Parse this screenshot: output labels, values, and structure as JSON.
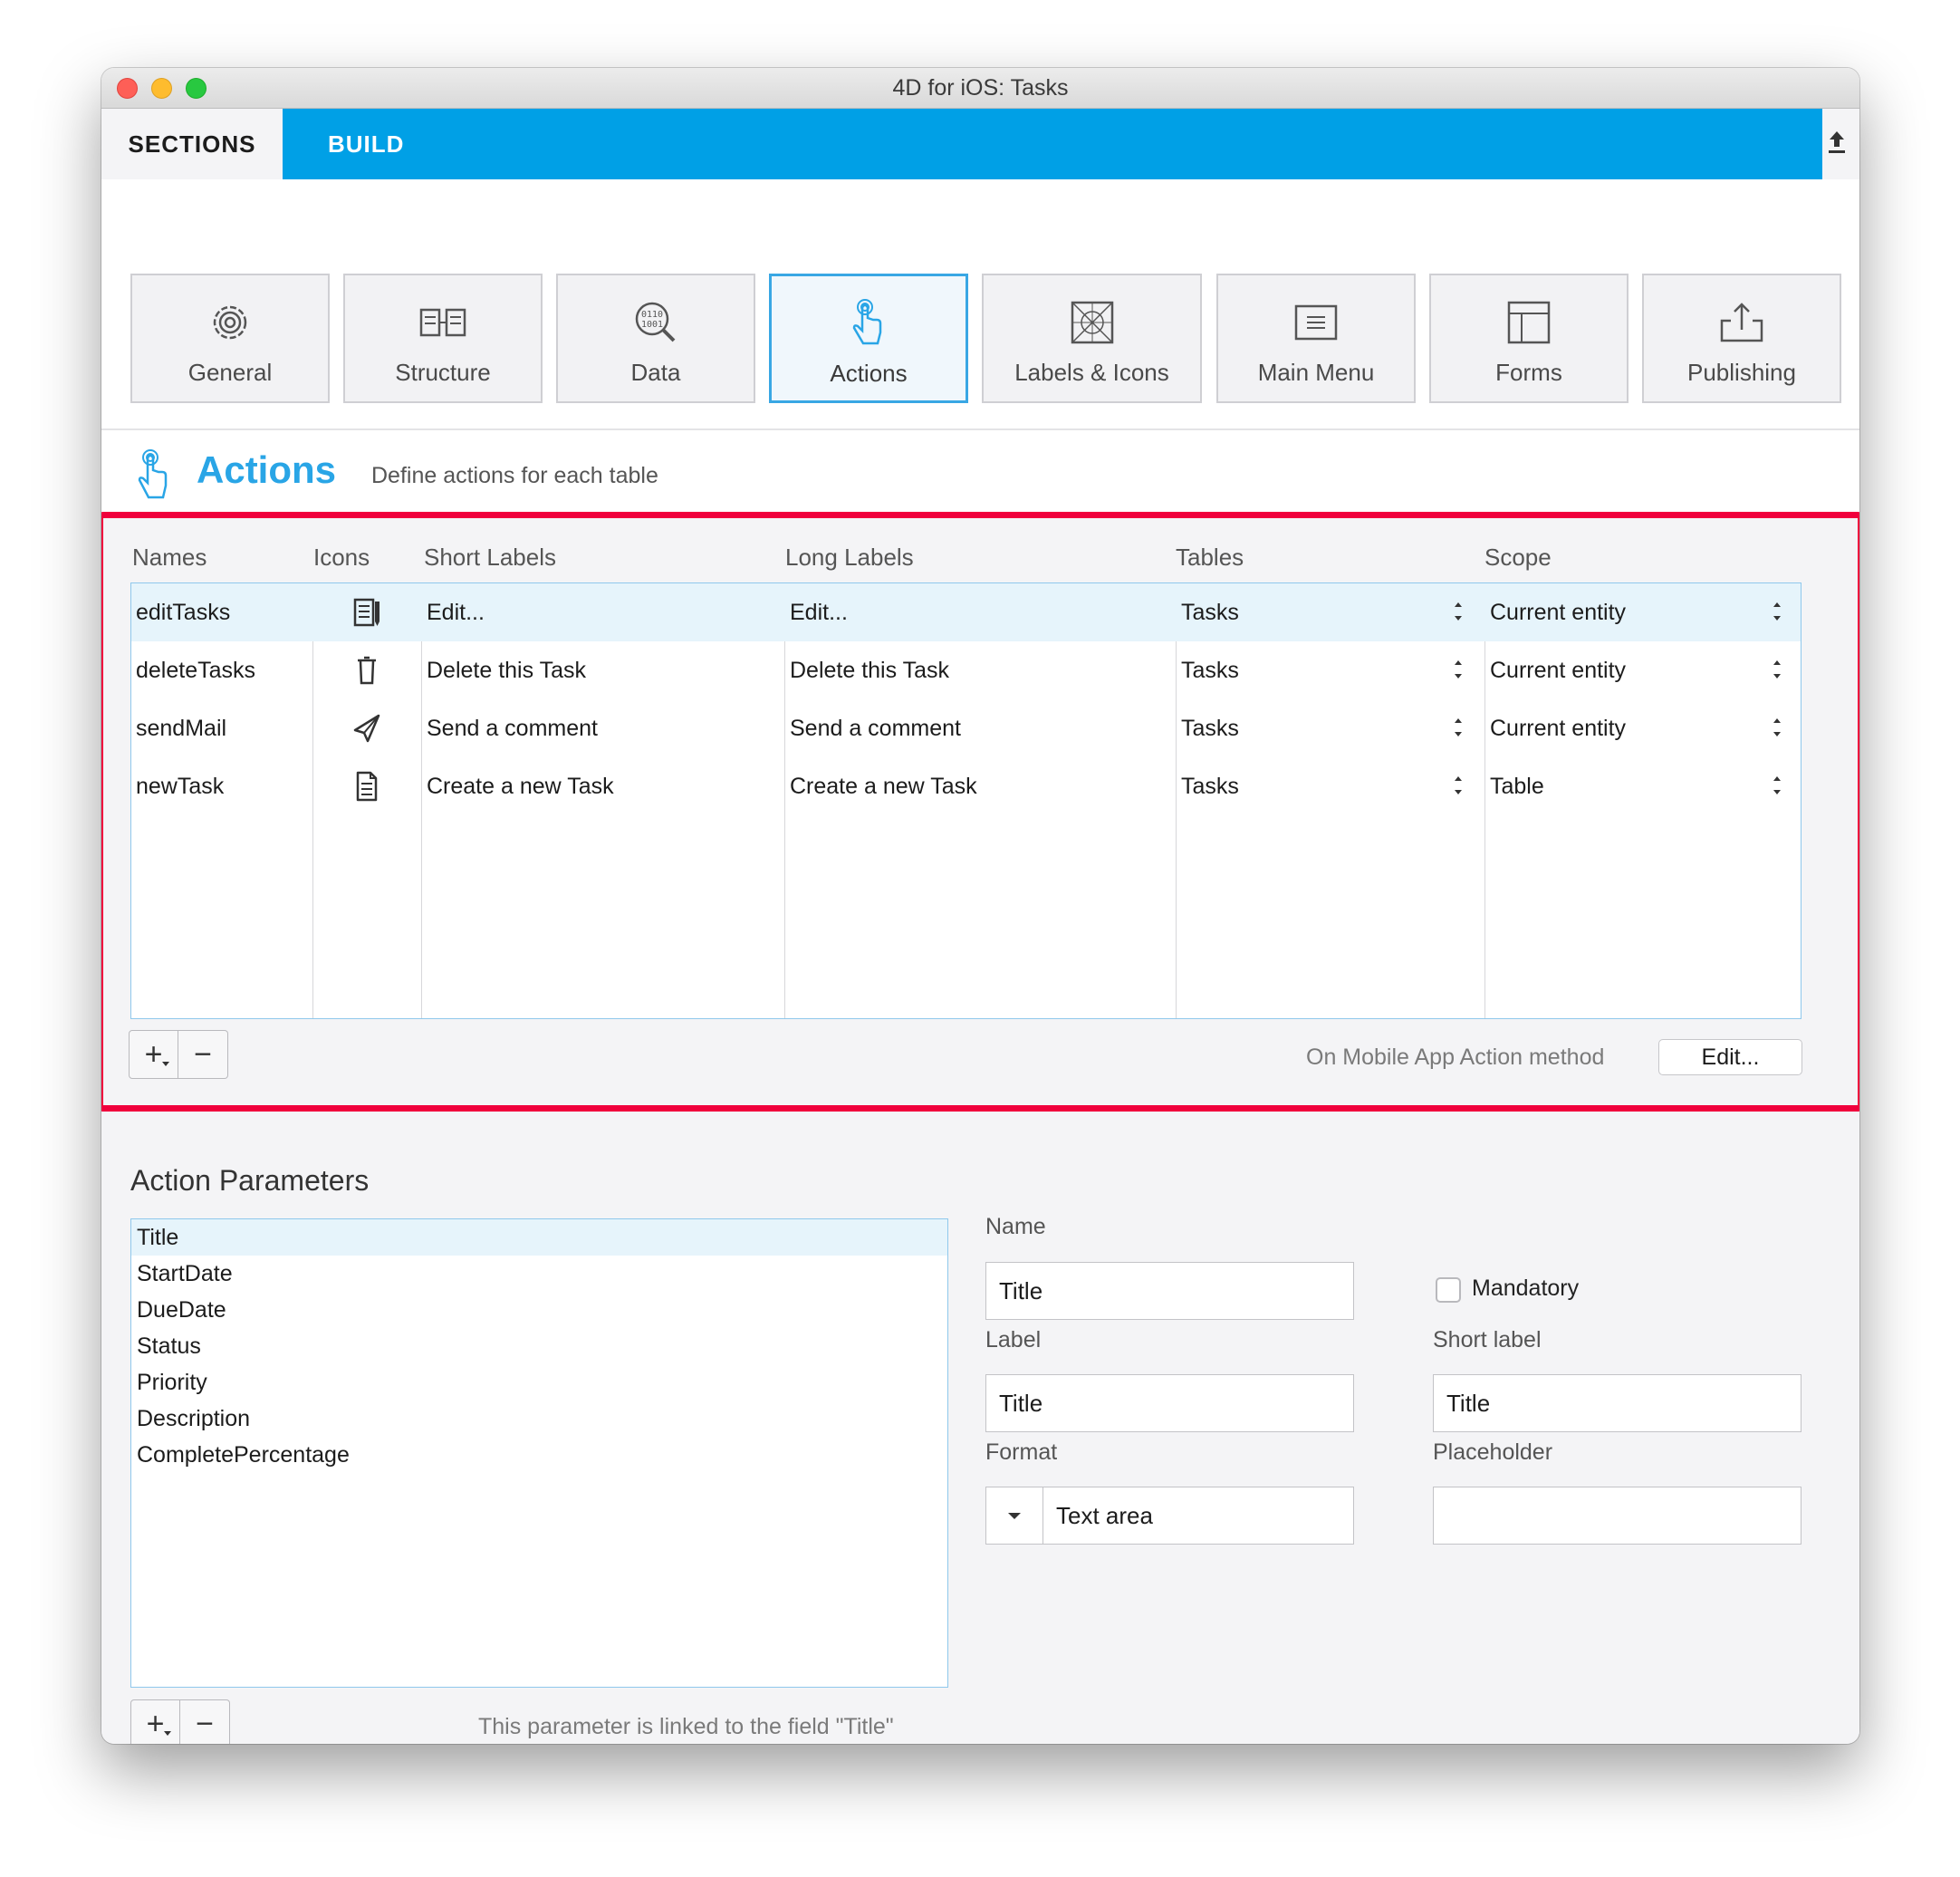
{
  "window": {
    "title": "4D for iOS: Tasks"
  },
  "tabs": {
    "sections": "SECTIONS",
    "build": "BUILD"
  },
  "sections": [
    {
      "label": "General",
      "icon": "gear-icon"
    },
    {
      "label": "Structure",
      "icon": "structure-icon"
    },
    {
      "label": "Data",
      "icon": "data-icon"
    },
    {
      "label": "Actions",
      "icon": "pointer-hand-icon",
      "active": true
    },
    {
      "label": "Labels & Icons",
      "icon": "grid-icon"
    },
    {
      "label": "Main Menu",
      "icon": "menu-icon"
    },
    {
      "label": "Forms",
      "icon": "forms-icon"
    },
    {
      "label": "Publishing",
      "icon": "publish-icon"
    }
  ],
  "header": {
    "title": "Actions",
    "description": "Define actions for each table"
  },
  "actions_table": {
    "columns": [
      "Names",
      "Icons",
      "Short Labels",
      "Long Labels",
      "Tables",
      "Scope"
    ],
    "rows": [
      {
        "name": "editTasks",
        "icon": "edit-document-icon",
        "short_label": "Edit...",
        "long_label": "Edit...",
        "table": "Tasks",
        "scope": "Current entity"
      },
      {
        "name": "deleteTasks",
        "icon": "trash-icon",
        "short_label": "Delete this Task",
        "long_label": "Delete this Task",
        "table": "Tasks",
        "scope": "Current entity"
      },
      {
        "name": "sendMail",
        "icon": "paper-plane-icon",
        "short_label": "Send a comment",
        "long_label": "Send a comment",
        "table": "Tasks",
        "scope": "Current entity"
      },
      {
        "name": "newTask",
        "icon": "new-document-icon",
        "short_label": "Create a new Task",
        "long_label": "Create a new Task",
        "table": "Tasks",
        "scope": "Table"
      }
    ],
    "method_label": "On Mobile App Action method",
    "edit_button": "Edit..."
  },
  "params": {
    "title": "Action Parameters",
    "items": [
      "Title",
      "StartDate",
      "DueDate",
      "Status",
      "Priority",
      "Description",
      "CompletePercentage"
    ],
    "linked_note": "This parameter is linked to the field \"Title\"",
    "name_label": "Name",
    "name_value": "Title",
    "mandatory_label": "Mandatory",
    "label_label": "Label",
    "label_value": "Title",
    "short_label_label": "Short label",
    "short_label_value": "Title",
    "format_label": "Format",
    "format_value": "Text area",
    "placeholder_label": "Placeholder",
    "placeholder_value": ""
  },
  "colors": {
    "accent": "#00a0e6",
    "highlight": "#f0003c",
    "selection": "#e6f4fb"
  }
}
